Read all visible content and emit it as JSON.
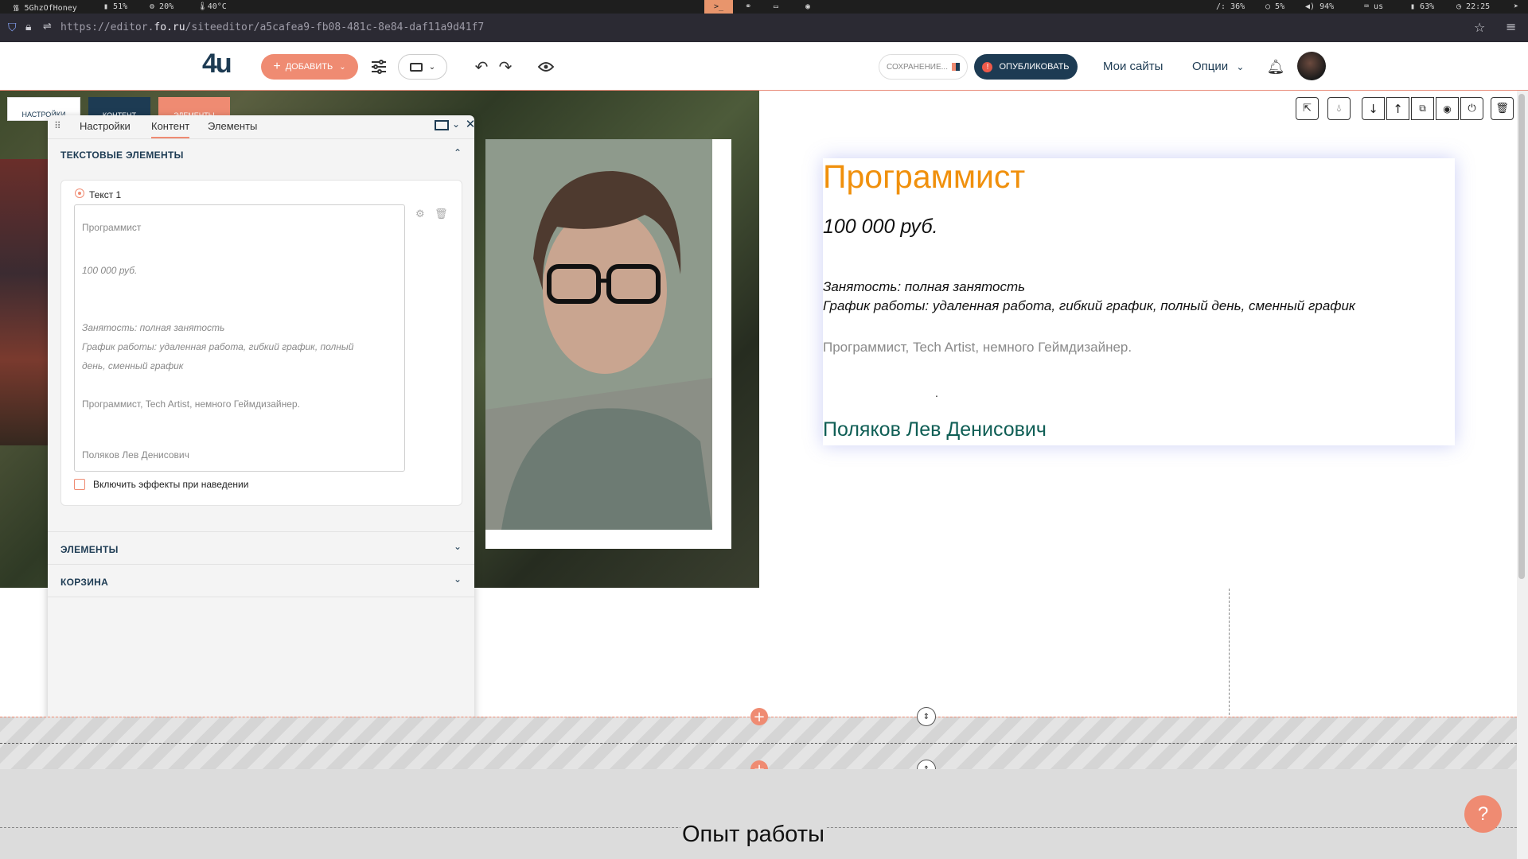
{
  "system_bar": {
    "wifi": "5GhzOfHoney",
    "battery_left": "51%",
    "cpu": "20%",
    "temp": "40°C",
    "disk": "/: 36%",
    "load": "5%",
    "volume": "94%",
    "layout": "us",
    "battery": "63%",
    "time": "22:25"
  },
  "browser": {
    "url_prefix": "https://editor.",
    "url_host": "fo.ru",
    "url_rest": "/siteeditor/a5cafea9-fb08-481c-8e84-daf11a9d41f7"
  },
  "toolbar": {
    "logo": "4u",
    "add_label": "ДОБАВИТЬ",
    "saving_label": "СОХРАНЕНИЕ...",
    "publish_label": "ОПУБЛИКОВАТЬ",
    "my_sites": "Мои сайты",
    "options": "Опции"
  },
  "section_tabs": {
    "settings": "НАСТРОЙКИ",
    "content": "КОНТЕНТ",
    "elements": "ЭЛЕМЕНТЫ"
  },
  "panel": {
    "tabs": [
      "Настройки",
      "Контент",
      "Элементы"
    ],
    "text_elements_title": "ТЕКСТОВЫЕ ЭЛЕМЕНТЫ",
    "text_item_label": "Текст 1",
    "textarea_lines": {
      "l1": "Программист",
      "l2": "100 000 руб.",
      "l3": "Занятость: полная занятость",
      "l4": "График работы: удаленная работа, гибкий график, полный",
      "l5": "день, сменный график",
      "l6": "Программист, Tech Artist, немного Геймдизайнер.",
      "l7": "Поляков Лев Денисович"
    },
    "hover_effects_label": "Включить эффекты при наведении",
    "elements_title": "ЭЛЕМЕНТЫ",
    "cart_title": "КОРЗИНА"
  },
  "resume": {
    "title": "Программист",
    "salary": "100 000 руб.",
    "employment": "Занятость: полная занятость",
    "schedule": "График работы: удаленная работа, гибкий график, полный день, сменный график",
    "about": "Программист, Tech Artist, немного Геймдизайнер.",
    "dot": ".",
    "name": "Поляков Лев Денисович"
  },
  "next_section": {
    "title": "Опыт работы"
  },
  "help": "?",
  "colors": {
    "accent": "#ef8b72",
    "navy": "#1d3b53",
    "title_orange": "#f0900c",
    "name_green": "#0f5e55"
  }
}
